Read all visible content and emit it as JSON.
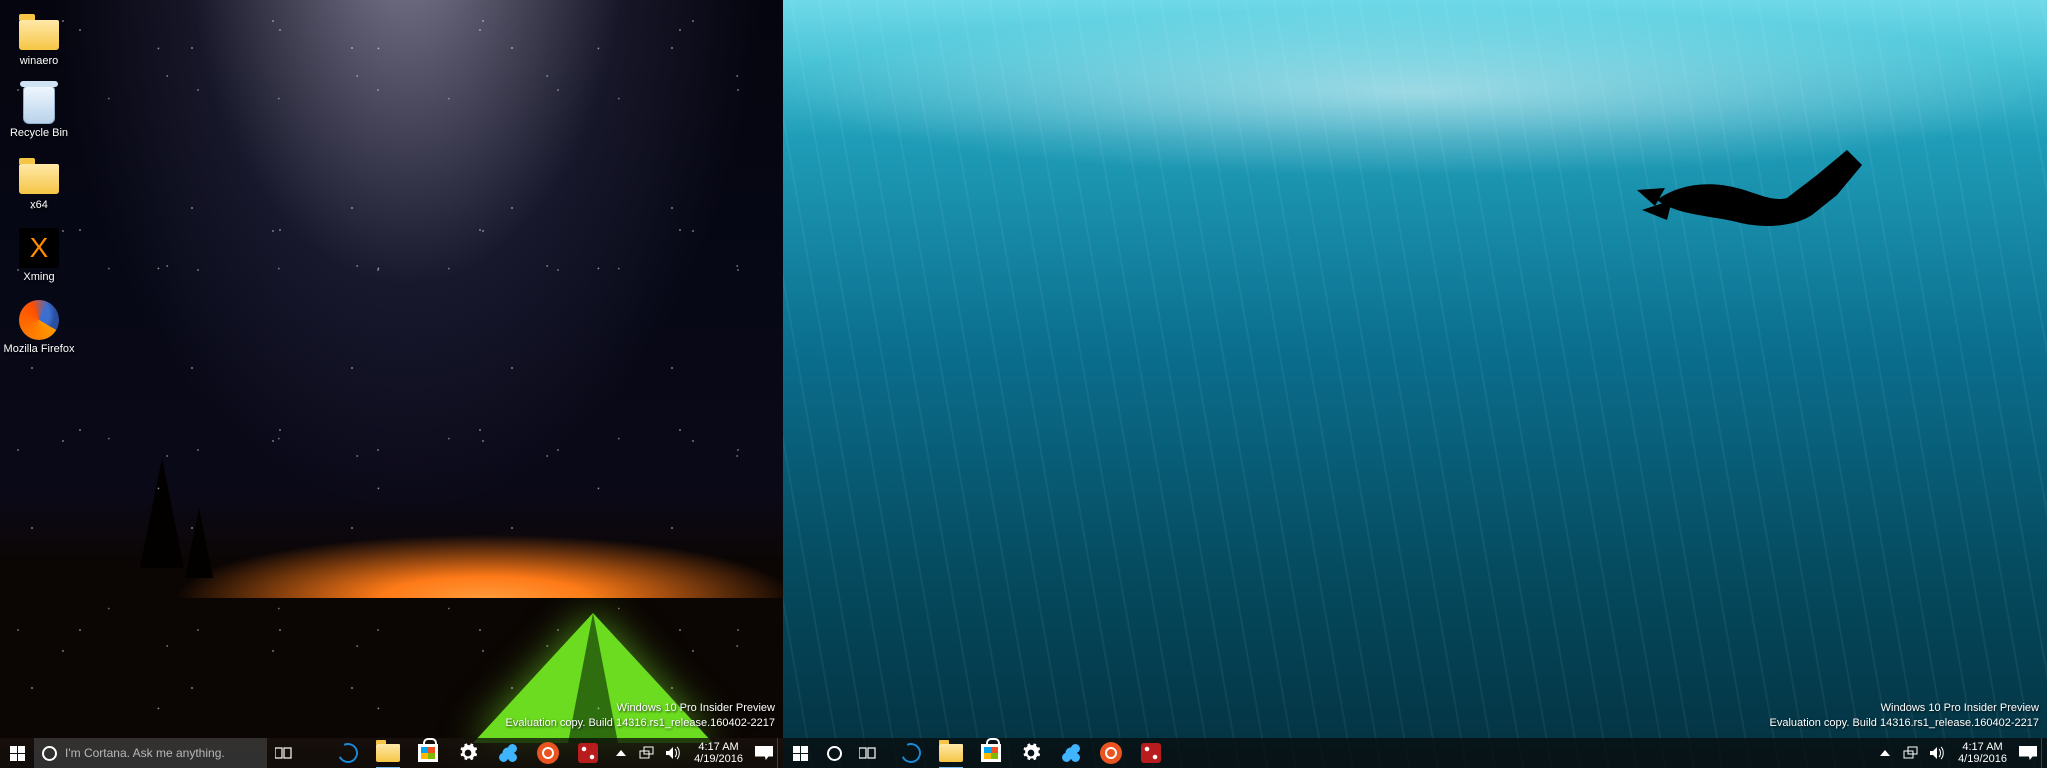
{
  "left": {
    "desktop_icons": [
      {
        "label": "winaero",
        "type": "folder"
      },
      {
        "label": "Recycle Bin",
        "type": "bin"
      },
      {
        "label": "x64",
        "type": "folder"
      },
      {
        "label": "Xming",
        "type": "x"
      },
      {
        "label": "Mozilla Firefox",
        "type": "firefox"
      }
    ],
    "watermark": {
      "line1": "Windows 10 Pro Insider Preview",
      "line2": "Evaluation copy. Build 14316.rs1_release.160402-2217"
    },
    "taskbar": {
      "cortana_placeholder": "I'm Cortana. Ask me anything.",
      "clock_time": "4:17 AM",
      "clock_date": "4/19/2016"
    }
  },
  "right": {
    "watermark": {
      "line1": "Windows 10 Pro Insider Preview",
      "line2": "Evaluation copy. Build 14316.rs1_release.160402-2217"
    },
    "taskbar": {
      "clock_time": "4:17 AM",
      "clock_date": "4/19/2016"
    }
  }
}
